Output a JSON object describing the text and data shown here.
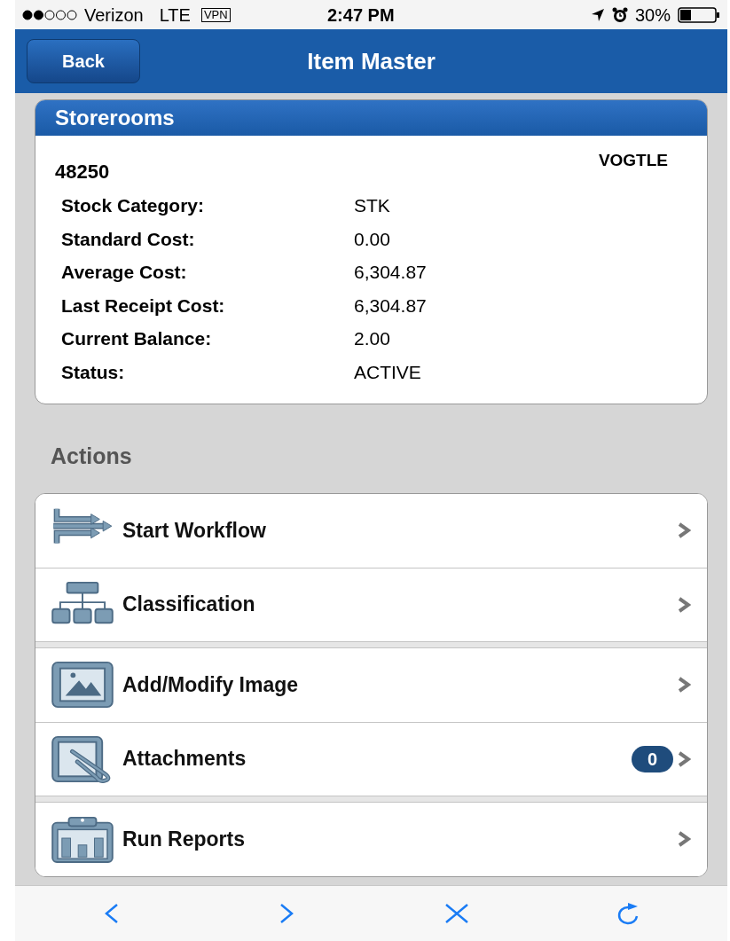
{
  "status_bar": {
    "signal_dots": [
      {
        "filled": true
      },
      {
        "filled": true
      },
      {
        "filled": false
      },
      {
        "filled": false
      },
      {
        "filled": false
      }
    ],
    "carrier": "Verizon",
    "network": "LTE",
    "vpn": "VPN",
    "time": "2:47 PM",
    "battery": "30%"
  },
  "nav_bar": {
    "back": "Back",
    "title": "Item Master"
  },
  "storerooms": {
    "title": "Storerooms",
    "id": "48250",
    "site": "VOGTLE",
    "fields": [
      {
        "label": "Stock Category:",
        "value": "STK"
      },
      {
        "label": "Standard Cost:",
        "value": "0.00"
      },
      {
        "label": "Average Cost:",
        "value": "6,304.87"
      },
      {
        "label": "Last Receipt Cost:",
        "value": "6,304.87"
      },
      {
        "label": "Current Balance:",
        "value": "2.00"
      },
      {
        "label": "Status:",
        "value": "ACTIVE"
      }
    ]
  },
  "actions": {
    "title": "Actions",
    "groups": [
      [
        {
          "kind": "workflow",
          "label": "Start Workflow"
        },
        {
          "kind": "classification",
          "label": "Classification"
        }
      ],
      [
        {
          "kind": "image",
          "label": "Add/Modify Image"
        },
        {
          "kind": "attachments",
          "label": "Attachments",
          "badge": "0"
        }
      ],
      [
        {
          "kind": "reports",
          "label": "Run Reports"
        }
      ]
    ]
  },
  "toolbar": [
    {
      "kind": "back"
    },
    {
      "kind": "forward"
    },
    {
      "kind": "close"
    },
    {
      "kind": "reload"
    }
  ]
}
